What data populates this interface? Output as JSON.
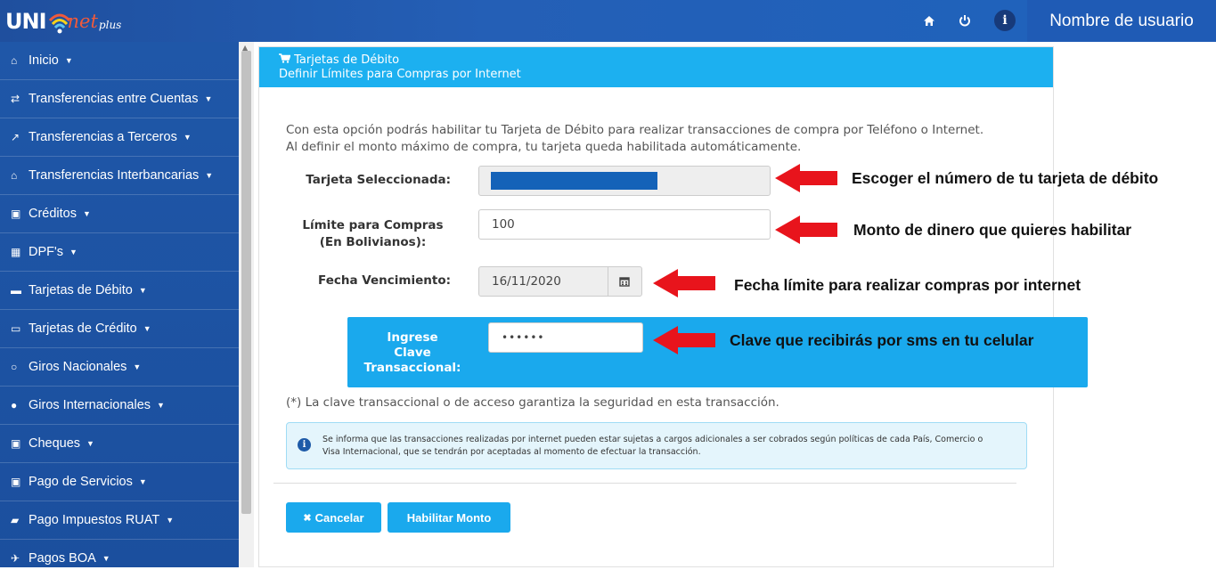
{
  "header": {
    "logo_uni": "UNI",
    "logo_net": "net",
    "logo_plus": "plus",
    "username": "Nombre de usuario",
    "icons": [
      "home-icon",
      "power-icon",
      "info-icon"
    ]
  },
  "sidebar": {
    "items": [
      {
        "label": "Inicio",
        "icon": "home-icon"
      },
      {
        "label": "Transferencias entre Cuentas",
        "icon": "exchange-icon"
      },
      {
        "label": "Transferencias a Terceros",
        "icon": "external-link-icon"
      },
      {
        "label": "Transferencias Interbancarias",
        "icon": "bank-icon"
      },
      {
        "label": "Créditos",
        "icon": "money-icon"
      },
      {
        "label": "DPF's",
        "icon": "calendar-icon"
      },
      {
        "label": "Tarjetas de Débito",
        "icon": "card-icon"
      },
      {
        "label": "Tarjetas de Crédito",
        "icon": "credit-card-icon"
      },
      {
        "label": "Giros Nacionales",
        "icon": "circle-icon"
      },
      {
        "label": "Giros Internacionales",
        "icon": "globe-icon"
      },
      {
        "label": "Cheques",
        "icon": "money-icon"
      },
      {
        "label": "Pago de Servicios",
        "icon": "money-icon"
      },
      {
        "label": "Pago Impuestos RUAT",
        "icon": "car-icon"
      },
      {
        "label": "Pagos BOA",
        "icon": "plane-icon"
      }
    ]
  },
  "panel": {
    "title": "Tarjetas de Débito",
    "subtitle": "Definir Límites para Compras por Internet",
    "intro_line1": "Con esta opción podrás habilitar tu Tarjeta de Débito para realizar transacciones de compra por Teléfono o Internet.",
    "intro_line2": "Al definir el monto máximo de compra, tu tarjeta queda habilitada automáticamente.",
    "card_label": "Tarjeta Seleccionada:",
    "limit_label_1": "Límite para Compras",
    "limit_label_2": "(En Bolivianos):",
    "limit_value": "100",
    "expiry_label": "Fecha Vencimiento:",
    "expiry_value": "16/11/2020",
    "password_label_1": "Ingrese",
    "password_label_2": "Clave",
    "password_label_3": "Transaccional:",
    "password_value": "••••••",
    "security_note": "(*) La clave transaccional o de acceso garantiza la seguridad en esta transacción.",
    "alert_line1": "Se informa que las transacciones realizadas por internet pueden estar sujetas a cargos adicionales a ser cobrados según políticas de cada País, Comercio o",
    "alert_line2": "Visa Internacional, que se tendrán por aceptadas al momento de efectuar la transacción.",
    "cancel_label": "Cancelar",
    "submit_label": "Habilitar Monto"
  },
  "annotations": {
    "card": "Escoger el número de tu tarjeta de débito",
    "limit": "Monto de dinero que quieres habilitar",
    "expiry": "Fecha límite para realizar compras por internet",
    "password": "Clave que recibirás por sms en tu celular"
  },
  "colors": {
    "accent": "#1aa9ed",
    "sidebar": "#1f57a8",
    "arrow": "#e8141c"
  }
}
